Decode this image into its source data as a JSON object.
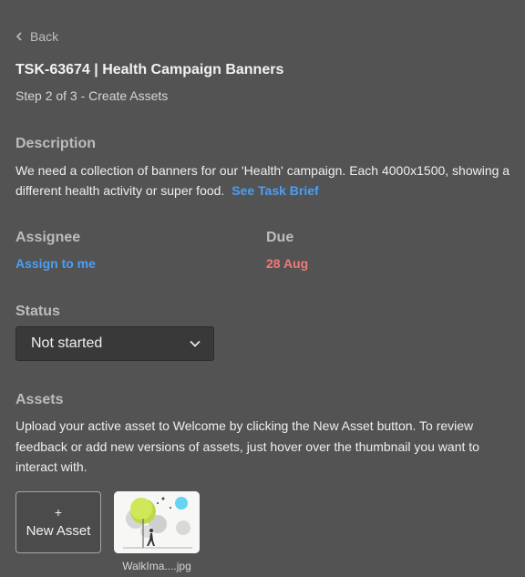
{
  "nav": {
    "back_label": "Back"
  },
  "task": {
    "title": "TSK-63674 | Health Campaign Banners",
    "step": "Step 2 of 3 - Create Assets"
  },
  "description": {
    "label": "Description",
    "text": "We need a collection of banners for our 'Health' campaign. Each 4000x1500, showing a different health activity or super food.",
    "brief_link": "See Task Brief"
  },
  "assignee": {
    "label": "Assignee",
    "action": "Assign to me"
  },
  "due": {
    "label": "Due",
    "value": "28 Aug"
  },
  "status": {
    "label": "Status",
    "selected": "Not started"
  },
  "assets": {
    "label": "Assets",
    "instructions": "Upload your active asset to Welcome by clicking the New Asset button. To review feedback or add new versions of assets, just hover over the thumbnail you want to interact with.",
    "new_asset_plus": "+",
    "new_asset_label": "New Asset",
    "items": [
      {
        "filename": "WalkIma....jpg"
      }
    ]
  },
  "colors": {
    "background": "#535353",
    "link": "#4a9ff5",
    "due": "#f27878"
  }
}
